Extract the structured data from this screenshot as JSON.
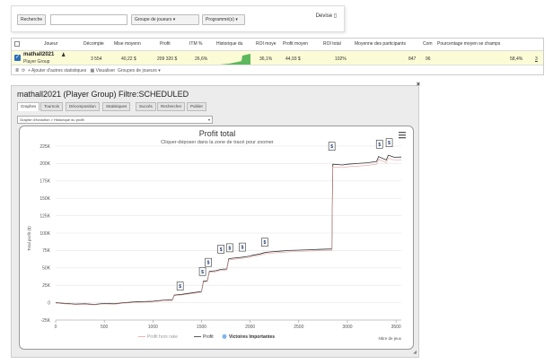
{
  "toolbar": {
    "search_label": "Recherche",
    "search_value": "",
    "group_label": "Groupe de joueurs",
    "scheduled_label": "Programmé(s)",
    "devise_label": "Devise"
  },
  "table": {
    "headers": [
      "Joueur",
      "Décompte",
      "Mise moyenn",
      "Profit",
      "ITM %",
      "Historique du",
      "ROI moye",
      "Profit moyen",
      "ROI total",
      "Moyenne des participants",
      "Com",
      "Pourcentage moyen se champs"
    ],
    "row": {
      "player": "mathall2021",
      "group": "Player Group",
      "count": "3 554",
      "avg_stake": "40,22 $",
      "profit": "209 320 $",
      "itm": "26,6%",
      "roi_avg": "36,1%",
      "profit_avg": "44,93 $",
      "roi_total": "102%",
      "avg_participants": "847",
      "com": "96",
      "avg_field_pct": "58,4%",
      "extra": "3"
    },
    "tools": {
      "add_stats": "Ajouter d'autres statistiques",
      "view": "Visualiser",
      "groups": "Groupes de joueurs"
    }
  },
  "panel": {
    "title": "mathall2021 (Player Group) Filtre:SCHEDULED",
    "tabs": [
      "Graphes",
      "Tournois",
      "Décomposition",
      "Statistiques",
      "Succès",
      "Rechercher",
      "Publier"
    ],
    "active_tab": 0,
    "chart_select": "Graphe d'évolution > Historique du profit"
  },
  "chart_data": {
    "type": "line",
    "title": "Profit total",
    "subtitle": "Cliquer-déposer dans la zone de tracé pour zoomer",
    "ylabel": "Total profit ($)",
    "xlabel": "Nbre de jeux",
    "xlim": [
      0,
      3554
    ],
    "ylim": [
      -25000,
      225000
    ],
    "x_ticks": [
      "0",
      "500",
      "1000",
      "1500",
      "2000",
      "2500",
      "3000",
      "3500"
    ],
    "y_ticks": [
      "-25K",
      "0",
      "25K",
      "50K",
      "75K",
      "100K",
      "125K",
      "150K",
      "175K",
      "200K",
      "225K"
    ],
    "legend": [
      "Profit hors rake",
      "Profit",
      "Victoires Importantes"
    ],
    "series": [
      {
        "name": "Profit",
        "color": "#333333",
        "points": [
          [
            0,
            0
          ],
          [
            100,
            -1000
          ],
          [
            200,
            -2000
          ],
          [
            300,
            -1500
          ],
          [
            400,
            -2500
          ],
          [
            500,
            -1000
          ],
          [
            600,
            -1500
          ],
          [
            700,
            0
          ],
          [
            800,
            1000
          ],
          [
            900,
            1500
          ],
          [
            1000,
            2000
          ],
          [
            1100,
            3500
          ],
          [
            1200,
            4000
          ],
          [
            1220,
            11000
          ],
          [
            1300,
            12000
          ],
          [
            1400,
            14000
          ],
          [
            1500,
            16000
          ],
          [
            1520,
            31000
          ],
          [
            1560,
            31500
          ],
          [
            1580,
            45000
          ],
          [
            1650,
            46000
          ],
          [
            1700,
            48000
          ],
          [
            1760,
            48500
          ],
          [
            1780,
            63000
          ],
          [
            1830,
            64000
          ],
          [
            1900,
            65000
          ],
          [
            2000,
            67000
          ],
          [
            2020,
            68000
          ],
          [
            2100,
            70000
          ],
          [
            2150,
            72000
          ],
          [
            2200,
            73000
          ],
          [
            2300,
            74000
          ],
          [
            2400,
            75000
          ],
          [
            2500,
            75500
          ],
          [
            2600,
            76000
          ],
          [
            2700,
            76500
          ],
          [
            2800,
            77000
          ],
          [
            2840,
            77000
          ],
          [
            2850,
            199000
          ],
          [
            2950,
            198000
          ],
          [
            3000,
            199000
          ],
          [
            3100,
            200000
          ],
          [
            3200,
            201000
          ],
          [
            3300,
            203000
          ],
          [
            3320,
            210000
          ],
          [
            3400,
            205000
          ],
          [
            3420,
            212000
          ],
          [
            3480,
            209000
          ],
          [
            3554,
            209320
          ]
        ]
      }
    ],
    "important_wins": [
      [
        1280,
        11000
      ],
      [
        1510,
        32000
      ],
      [
        1570,
        45000
      ],
      [
        1700,
        64000
      ],
      [
        1790,
        66000
      ],
      [
        1920,
        67000
      ],
      [
        2150,
        74000
      ],
      [
        2840,
        212000
      ],
      [
        3330,
        215000
      ],
      [
        3430,
        217000
      ]
    ]
  },
  "colors": {
    "accent": "#7cb5ec",
    "win_marker": "#1e3a6e",
    "row_highlight": "#fbfbd6",
    "histogram_green": "#5cb85c"
  }
}
